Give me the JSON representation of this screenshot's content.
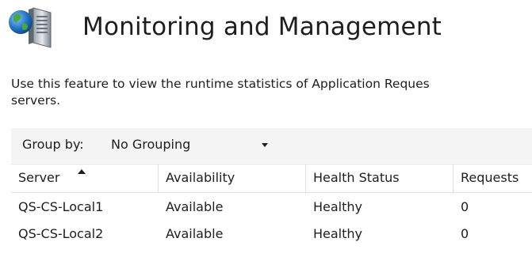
{
  "header": {
    "title": "Monitoring and Management",
    "icon": "server-globe-icon"
  },
  "description": {
    "line1": "Use this feature to view the runtime statistics of Application Reques",
    "line2": "servers."
  },
  "group_by": {
    "label": "Group by:",
    "value": "No Grouping"
  },
  "grid": {
    "columns": [
      "Server",
      "Availability",
      "Health Status",
      "Requests"
    ],
    "sort_column": "Server",
    "sort_direction": "ascending",
    "rows": [
      {
        "server": "QS-CS-Local1",
        "availability": "Available",
        "health": "Healthy",
        "requests": "0"
      },
      {
        "server": "QS-CS-Local2",
        "availability": "Available",
        "health": "Healthy",
        "requests": "0"
      }
    ]
  },
  "colors": {
    "text": "#1e1e1e",
    "toolbar_bg": "#f4f4f4",
    "grid_lines": "#e2e2e2",
    "globe_blue": "#1f6fc0",
    "globe_green": "#4aa83c"
  }
}
